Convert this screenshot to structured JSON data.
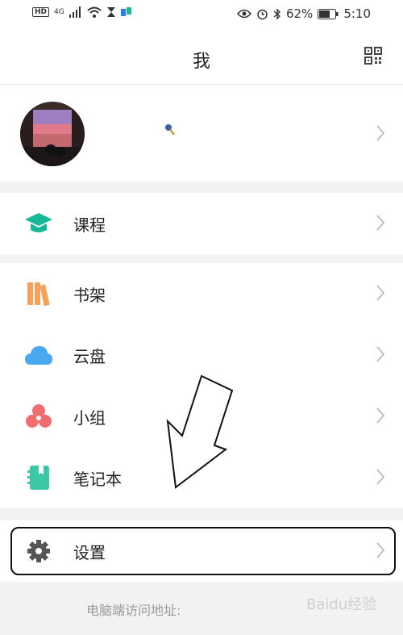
{
  "status_bar": {
    "hd_badge": "HD",
    "network": "4G",
    "battery_percent": "62%",
    "time": "5:10"
  },
  "header": {
    "title": "我"
  },
  "menu": {
    "courses": "课程",
    "bookshelf": "书架",
    "cloud_disk": "云盘",
    "groups": "小组",
    "notebook": "笔记本",
    "settings": "设置"
  },
  "footer": {
    "pc_access": "电脑端访问地址:"
  },
  "watermark": "Baidu经验",
  "colors": {
    "courses_icon": "#1ab89a",
    "bookshelf_icon": "#f5a25d",
    "cloud_icon": "#4aa8f0",
    "groups_icon": "#f26d6d",
    "notebook_icon": "#3cc7a7",
    "settings_icon": "#555555"
  }
}
